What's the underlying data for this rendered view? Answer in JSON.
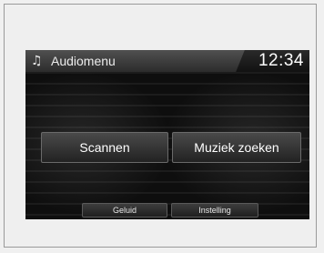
{
  "header": {
    "icon": "music-note-icon",
    "icon_glyph": "♫",
    "title": "Audiomenu",
    "clock": "12:34"
  },
  "main": {
    "buttons": [
      {
        "label": "Scannen"
      },
      {
        "label": "Muziek zoeken"
      }
    ]
  },
  "footer": {
    "buttons": [
      {
        "label": "Geluid"
      },
      {
        "label": "Instelling"
      }
    ]
  },
  "colors": {
    "screen_background": "#0e0e0e",
    "header_background": "#3a3a3a",
    "button_background": "#333333",
    "text": "#ffffff"
  }
}
